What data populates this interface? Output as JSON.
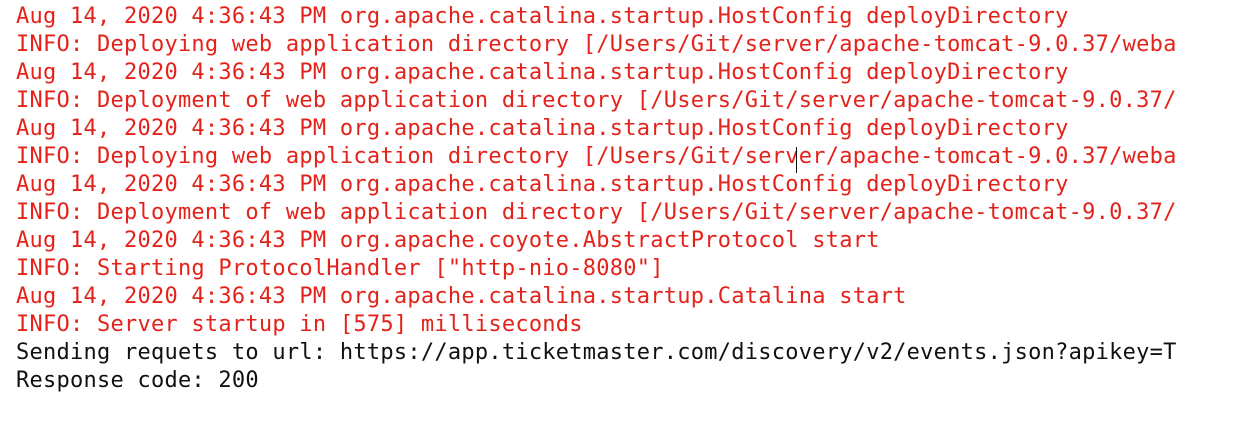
{
  "console": {
    "lines": [
      {
        "stream": "stderr",
        "text": "Aug 14, 2020 4:36:43 PM org.apache.catalina.startup.HostConfig deployDirectory"
      },
      {
        "stream": "stderr",
        "text": "INFO: Deploying web application directory [/Users/Git/server/apache-tomcat-9.0.37/weba"
      },
      {
        "stream": "stderr",
        "text": "Aug 14, 2020 4:36:43 PM org.apache.catalina.startup.HostConfig deployDirectory"
      },
      {
        "stream": "stderr",
        "text": "INFO: Deployment of web application directory [/Users/Git/server/apache-tomcat-9.0.37/"
      },
      {
        "stream": "stderr",
        "text": "Aug 14, 2020 4:36:43 PM org.apache.catalina.startup.HostConfig deployDirectory"
      },
      {
        "stream": "stderr",
        "text": "INFO: Deploying web application directory [/Users/Git/server/apache-tomcat-9.0.37/weba"
      },
      {
        "stream": "stderr",
        "text": "Aug 14, 2020 4:36:43 PM org.apache.catalina.startup.HostConfig deployDirectory"
      },
      {
        "stream": "stderr",
        "text": "INFO: Deployment of web application directory [/Users/Git/server/apache-tomcat-9.0.37/"
      },
      {
        "stream": "stderr",
        "text": "Aug 14, 2020 4:36:43 PM org.apache.coyote.AbstractProtocol start"
      },
      {
        "stream": "stderr",
        "text": "INFO: Starting ProtocolHandler [\"http-nio-8080\"]"
      },
      {
        "stream": "stderr",
        "text": "Aug 14, 2020 4:36:43 PM org.apache.catalina.startup.Catalina start"
      },
      {
        "stream": "stderr",
        "text": "INFO: Server startup in [575] milliseconds"
      },
      {
        "stream": "stdout",
        "text": "Sending requets to url: https://app.ticketmaster.com/discovery/v2/events.json?apikey=T"
      },
      {
        "stream": "stdout",
        "text": "Response code: 200"
      }
    ]
  },
  "colors": {
    "stderr": "#e3231b",
    "stdout": "#111111",
    "background": "#ffffff"
  }
}
